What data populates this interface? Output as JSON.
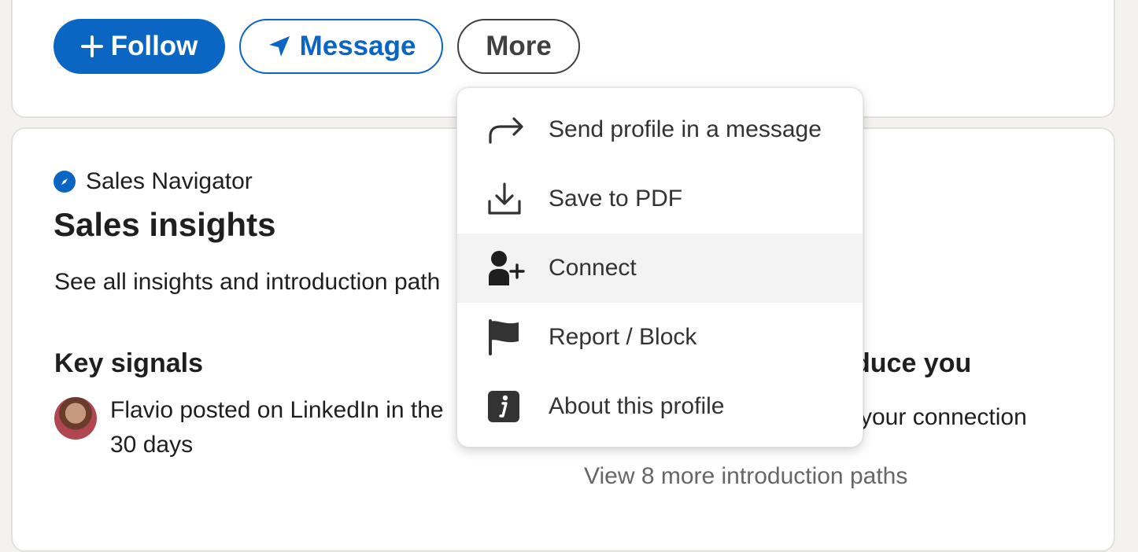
{
  "actions": {
    "follow_label": "Follow",
    "message_label": "Message",
    "more_label": "More"
  },
  "sales": {
    "brand": "Sales Navigator",
    "title": "Sales insights",
    "subtitle": "See all insights and introduction path"
  },
  "signals": {
    "heading": "Key signals",
    "line1": "Flavio posted on LinkedIn in the",
    "line2": "30 days"
  },
  "intro": {
    "heading": "duce you",
    "text": "your connection",
    "link": "View 8 more introduction paths"
  },
  "menu": {
    "items": [
      {
        "label": "Send profile in a message",
        "icon": "share-arrow-icon"
      },
      {
        "label": "Save to PDF",
        "icon": "download-icon"
      },
      {
        "label": "Connect",
        "icon": "add-person-icon"
      },
      {
        "label": "Report / Block",
        "icon": "flag-icon"
      },
      {
        "label": "About this profile",
        "icon": "info-icon"
      }
    ],
    "hovered": "Connect"
  },
  "colors": {
    "brand_blue": "#0a66c2",
    "background": "#f4f2ee"
  }
}
